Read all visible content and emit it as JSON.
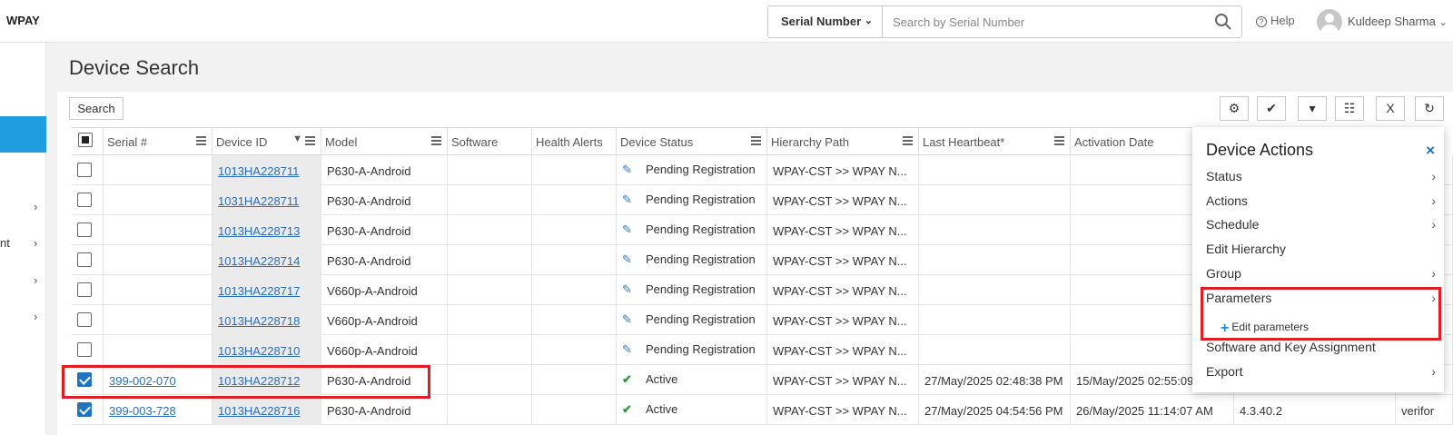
{
  "app": {
    "brand": "WPAY"
  },
  "header": {
    "search_type": "Serial Number",
    "search_placeholder": "Search by Serial Number",
    "help_label": "Help",
    "user_name": "Kuldeep Sharma"
  },
  "sidebar": {
    "items": [
      {
        "label": ""
      },
      {
        "label": "nt"
      },
      {
        "label": ""
      },
      {
        "label": ""
      }
    ],
    "chevron": "›"
  },
  "page": {
    "title": "Device Search",
    "search_button": "Search"
  },
  "toolbar": {
    "icons": [
      "settings-cycle-icon",
      "check-icon",
      "filter-icon",
      "columns-icon",
      "excel-icon",
      "refresh-icon"
    ]
  },
  "table": {
    "columns": [
      "Serial #",
      "Device ID",
      "Model",
      "Software",
      "Health Alerts",
      "Device Status",
      "Hierarchy Path",
      "Last Heartbeat*",
      "Activation Date"
    ],
    "rows": [
      {
        "checked": false,
        "serial": "",
        "device_id": "1013HA228711",
        "model": "P630-A-Android",
        "status": "Pending Registration",
        "status_type": "pending",
        "hierarchy": "WPAY-CST >> WPAY N...",
        "heartbeat": "",
        "activation": "",
        "extra1": "",
        "extra2": ""
      },
      {
        "checked": false,
        "serial": "",
        "device_id": "1031HA228711",
        "model": "P630-A-Android",
        "status": "Pending Registration",
        "status_type": "pending",
        "hierarchy": "WPAY-CST >> WPAY N...",
        "heartbeat": "",
        "activation": "",
        "extra1": "",
        "extra2": ""
      },
      {
        "checked": false,
        "serial": "",
        "device_id": "1013HA228713",
        "model": "P630-A-Android",
        "status": "Pending Registration",
        "status_type": "pending",
        "hierarchy": "WPAY-CST >> WPAY N...",
        "heartbeat": "",
        "activation": "",
        "extra1": "",
        "extra2": ""
      },
      {
        "checked": false,
        "serial": "",
        "device_id": "1013HA228714",
        "model": "P630-A-Android",
        "status": "Pending Registration",
        "status_type": "pending",
        "hierarchy": "WPAY-CST >> WPAY N...",
        "heartbeat": "",
        "activation": "",
        "extra1": "",
        "extra2": ""
      },
      {
        "checked": false,
        "serial": "",
        "device_id": "1013HA228717",
        "model": "V660p-A-Android",
        "status": "Pending Registration",
        "status_type": "pending",
        "hierarchy": "WPAY-CST >> WPAY N...",
        "heartbeat": "",
        "activation": "",
        "extra1": "",
        "extra2": ""
      },
      {
        "checked": false,
        "serial": "",
        "device_id": "1013HA228718",
        "model": "V660p-A-Android",
        "status": "Pending Registration",
        "status_type": "pending",
        "hierarchy": "WPAY-CST >> WPAY N...",
        "heartbeat": "",
        "activation": "",
        "extra1": "",
        "extra2": ""
      },
      {
        "checked": false,
        "serial": "",
        "device_id": "1013HA228710",
        "model": "V660p-A-Android",
        "status": "Pending Registration",
        "status_type": "pending",
        "hierarchy": "WPAY-CST >> WPAY N...",
        "heartbeat": "",
        "activation": "",
        "extra1": "",
        "extra2": ""
      },
      {
        "checked": true,
        "serial": "399-002-070",
        "device_id": "1013HA228712",
        "model": "P630-A-Android",
        "status": "Active",
        "status_type": "active",
        "hierarchy": "WPAY-CST >> WPAY N...",
        "heartbeat": "27/May/2025 02:48:38 PM",
        "activation": "15/May/2025 02:55:09",
        "extra1": "",
        "extra2": ""
      },
      {
        "checked": true,
        "serial": "399-003-728",
        "device_id": "1013HA228716",
        "model": "P630-A-Android",
        "status": "Active",
        "status_type": "active",
        "hierarchy": "WPAY-CST >> WPAY N...",
        "heartbeat": "27/May/2025 04:54:56 PM",
        "activation": "26/May/2025 11:14:07 AM",
        "extra1": "4.3.40.2",
        "extra2": "verifor"
      }
    ]
  },
  "device_actions": {
    "title": "Device Actions",
    "close": "×",
    "items": [
      {
        "label": "Status",
        "chevron": "›"
      },
      {
        "label": "Actions",
        "chevron": "›"
      },
      {
        "label": "Schedule",
        "chevron": "›"
      },
      {
        "label": "Edit Hierarchy",
        "chevron": ""
      },
      {
        "label": "Group",
        "chevron": "›"
      },
      {
        "label": "Parameters",
        "chevron": "›"
      },
      {
        "label": "Software and Key Assignment",
        "chevron": ""
      },
      {
        "label": "Export",
        "chevron": "›"
      }
    ],
    "sub_item": "Edit parameters"
  },
  "colors": {
    "accent": "#1e9de0",
    "highlight": "#e01e24",
    "link": "#2a6eb8",
    "active": "#2a9d3a"
  }
}
